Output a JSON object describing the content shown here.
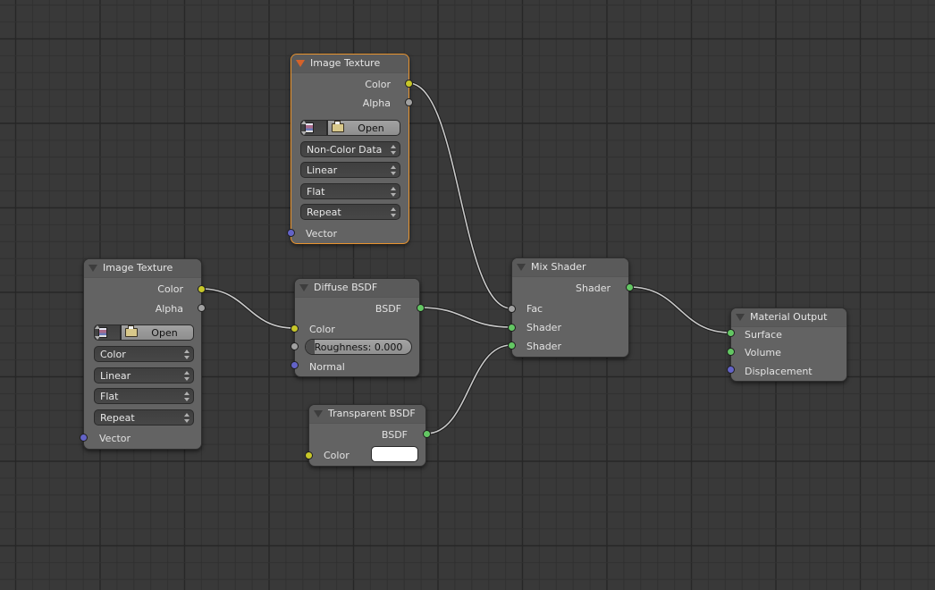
{
  "colors": {
    "background": "#393939",
    "grid_minor": "#313131",
    "grid_major": "#272727",
    "active_outline": "#e8932e",
    "socket_color": "#c7c729",
    "socket_float": "#a1a1a1",
    "socket_shader": "#63c763",
    "socket_vector": "#6363c7",
    "link": "#c9c9c9"
  },
  "nodes": {
    "image_texture_top": {
      "title": "Image Texture",
      "active": true,
      "outputs": [
        "Color",
        "Alpha"
      ],
      "open_label": "Open",
      "color_space": "Non-Color Data",
      "interpolation": "Linear",
      "projection": "Flat",
      "extension": "Repeat",
      "inputs": [
        "Vector"
      ]
    },
    "image_texture_left": {
      "title": "Image Texture",
      "active": false,
      "outputs": [
        "Color",
        "Alpha"
      ],
      "open_label": "Open",
      "color_space": "Color",
      "interpolation": "Linear",
      "projection": "Flat",
      "extension": "Repeat",
      "inputs": [
        "Vector"
      ]
    },
    "diffuse_bsdf": {
      "title": "Diffuse BSDF",
      "outputs": [
        "BSDF"
      ],
      "inputs": [
        "Color",
        "Normal"
      ],
      "roughness_label": "Roughness:",
      "roughness_value": "0.000",
      "roughness_text": "Roughness:  0.000"
    },
    "transparent_bsdf": {
      "title": "Transparent BSDF",
      "outputs": [
        "BSDF"
      ],
      "inputs": [
        "Color"
      ],
      "color_value": "#ffffff"
    },
    "mix_shader": {
      "title": "Mix Shader",
      "outputs": [
        "Shader"
      ],
      "inputs": [
        "Fac",
        "Shader",
        "Shader"
      ]
    },
    "material_output": {
      "title": "Material Output",
      "inputs": [
        "Surface",
        "Volume",
        "Displacement"
      ]
    }
  },
  "links": [
    {
      "from": "image_texture_top.Color",
      "to": "mix_shader.Fac"
    },
    {
      "from": "image_texture_left.Color",
      "to": "diffuse_bsdf.Color"
    },
    {
      "from": "diffuse_bsdf.BSDF",
      "to": "mix_shader.Shader1"
    },
    {
      "from": "transparent_bsdf.BSDF",
      "to": "mix_shader.Shader2"
    },
    {
      "from": "mix_shader.Shader",
      "to": "material_output.Surface"
    }
  ]
}
